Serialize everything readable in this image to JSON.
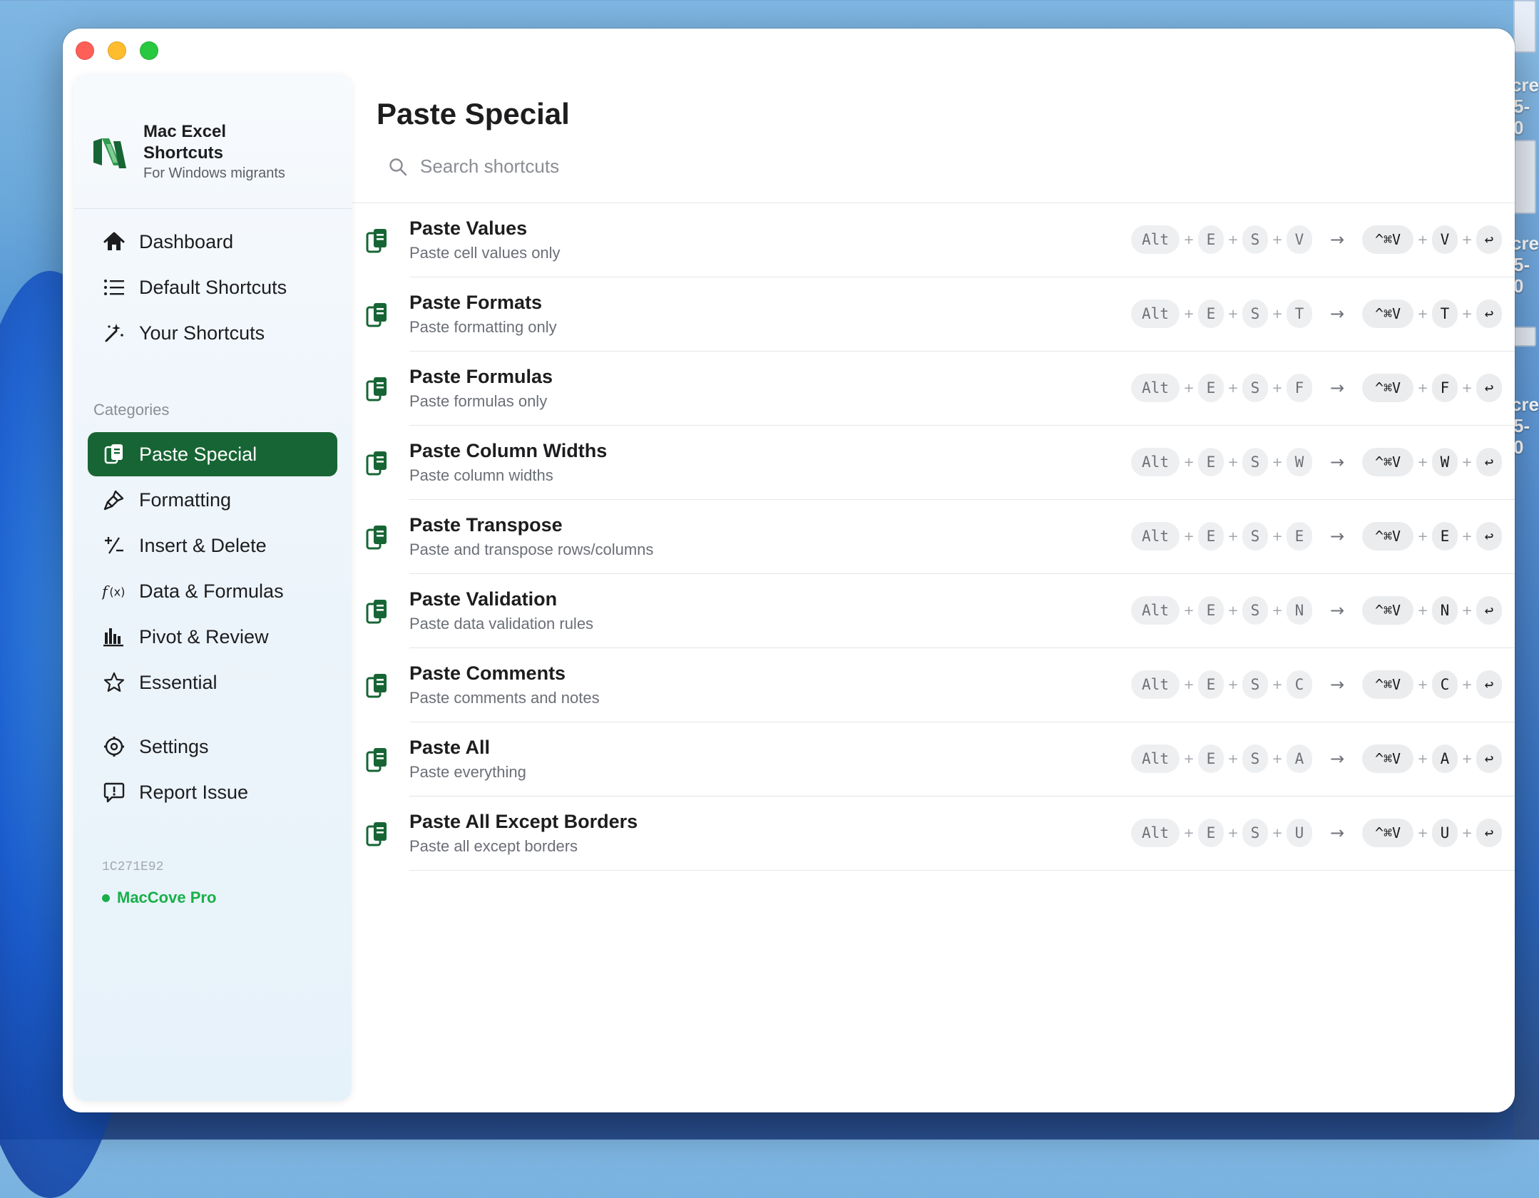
{
  "app": {
    "title": "Mac Excel Shortcuts",
    "subtitle": "For Windows migrants"
  },
  "colors": {
    "accent": "#176534",
    "pro": "#18b048"
  },
  "nav": {
    "main": [
      {
        "label": "Dashboard",
        "icon": "house-icon"
      },
      {
        "label": "Default Shortcuts",
        "icon": "list-icon"
      },
      {
        "label": "Your Shortcuts",
        "icon": "wand-icon"
      }
    ],
    "categories_heading": "Categories",
    "categories": [
      {
        "label": "Paste Special",
        "icon": "clipboard-icon",
        "active": true
      },
      {
        "label": "Formatting",
        "icon": "paintbrush-icon"
      },
      {
        "label": "Insert & Delete",
        "icon": "plus-minus-icon"
      },
      {
        "label": "Data & Formulas",
        "icon": "function-icon"
      },
      {
        "label": "Pivot & Review",
        "icon": "bar-chart-icon"
      },
      {
        "label": "Essential",
        "icon": "star-icon"
      }
    ],
    "footer": [
      {
        "label": "Settings",
        "icon": "gear-icon"
      },
      {
        "label": "Report Issue",
        "icon": "exclamation-bubble-icon"
      }
    ]
  },
  "build_id": "1C271E92",
  "plan": "MacCove Pro",
  "main": {
    "title": "Paste Special",
    "search_placeholder": "Search shortcuts"
  },
  "shortcuts": [
    {
      "title": "Paste Values",
      "desc": "Paste cell values only",
      "win": [
        "Alt",
        "E",
        "S",
        "V"
      ],
      "mac": [
        "^⌘V",
        "V",
        "↩"
      ]
    },
    {
      "title": "Paste Formats",
      "desc": "Paste formatting only",
      "win": [
        "Alt",
        "E",
        "S",
        "T"
      ],
      "mac": [
        "^⌘V",
        "T",
        "↩"
      ]
    },
    {
      "title": "Paste Formulas",
      "desc": "Paste formulas only",
      "win": [
        "Alt",
        "E",
        "S",
        "F"
      ],
      "mac": [
        "^⌘V",
        "F",
        "↩"
      ]
    },
    {
      "title": "Paste Column Widths",
      "desc": "Paste column widths",
      "win": [
        "Alt",
        "E",
        "S",
        "W"
      ],
      "mac": [
        "^⌘V",
        "W",
        "↩"
      ]
    },
    {
      "title": "Paste Transpose",
      "desc": "Paste and transpose rows/columns",
      "win": [
        "Alt",
        "E",
        "S",
        "E"
      ],
      "mac": [
        "^⌘V",
        "E",
        "↩"
      ]
    },
    {
      "title": "Paste Validation",
      "desc": "Paste data validation rules",
      "win": [
        "Alt",
        "E",
        "S",
        "N"
      ],
      "mac": [
        "^⌘V",
        "N",
        "↩"
      ]
    },
    {
      "title": "Paste Comments",
      "desc": "Paste comments and notes",
      "win": [
        "Alt",
        "E",
        "S",
        "C"
      ],
      "mac": [
        "^⌘V",
        "C",
        "↩"
      ]
    },
    {
      "title": "Paste All",
      "desc": "Paste everything",
      "win": [
        "Alt",
        "E",
        "S",
        "A"
      ],
      "mac": [
        "^⌘V",
        "A",
        "↩"
      ]
    },
    {
      "title": "Paste All Except Borders",
      "desc": "Paste all except borders",
      "win": [
        "Alt",
        "E",
        "S",
        "U"
      ],
      "mac": [
        "^⌘V",
        "U",
        "↩"
      ]
    }
  ],
  "desktop": {
    "label_fragments": [
      "cre",
      "5-0",
      "cre",
      "5-0",
      "cre",
      "5-0"
    ]
  }
}
